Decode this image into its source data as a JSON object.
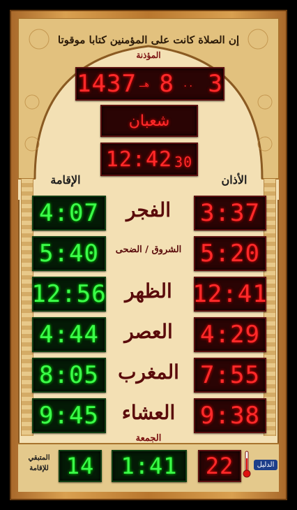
{
  "header": {
    "calligraphy": "إن الصلاة كانت على المؤمنين كتابا موقوتا",
    "muathin_label": "المؤذنة"
  },
  "date": {
    "year": "1437",
    "year_suffix": "هـ",
    "day": "8",
    "month_num": "3",
    "month_name": "شعبان"
  },
  "clock": {
    "time": "12:42",
    "seconds": "30"
  },
  "columns": {
    "adhan_label": "الأذان",
    "iqama_label": "الإقامة"
  },
  "prayers": [
    {
      "name": "الفجر",
      "adhan": "3:37",
      "iqama": "4:07"
    },
    {
      "name": "الشروق / الضحى",
      "adhan": "5:20",
      "iqama": "5:40"
    },
    {
      "name": "الظهر",
      "adhan": "12:41",
      "iqama": "12:56"
    },
    {
      "name": "العصر",
      "adhan": "4:29",
      "iqama": "4:44"
    },
    {
      "name": "المغرب",
      "adhan": "7:55",
      "iqama": "8:05"
    },
    {
      "name": "العشاء",
      "adhan": "9:38",
      "iqama": "9:45"
    }
  ],
  "footer": {
    "jumuah_label": "الجمعة",
    "jumuah_time": "1:41",
    "remaining_label": "المتبقي للإقامة",
    "remaining_value": "14",
    "temperature": "22",
    "logo_text": "الدليل"
  },
  "colors": {
    "led_red": "#ff2a2a",
    "led_green": "#3cff4a",
    "frame_gold": "#d9a050",
    "panel_cream": "#f3e0b4"
  }
}
